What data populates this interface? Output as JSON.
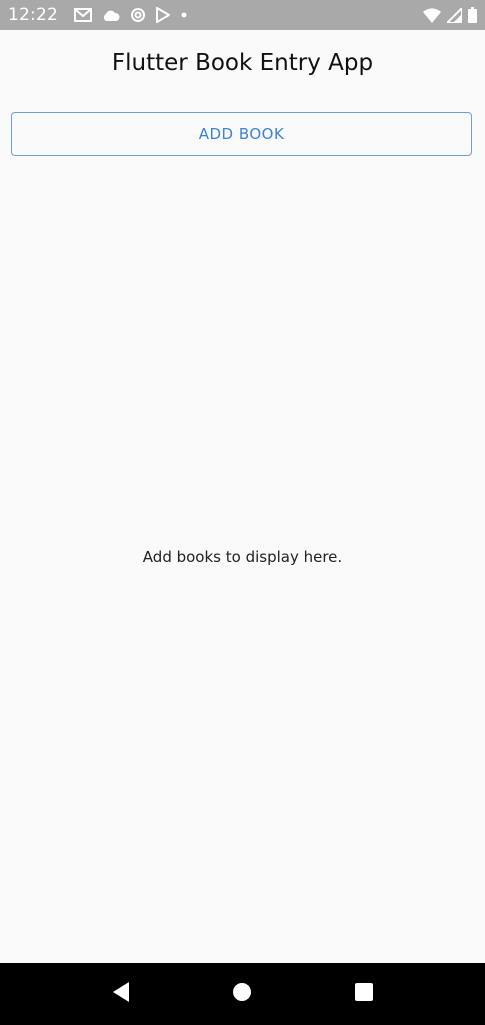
{
  "status_bar": {
    "time": "12:22",
    "left_icons": [
      "gmail-icon",
      "cloud-icon",
      "sync-icon",
      "play-store-icon",
      "dot-icon"
    ],
    "right_icons": [
      "wifi-icon",
      "signal-icon",
      "battery-icon"
    ]
  },
  "app": {
    "title": "Flutter Book Entry App",
    "add_button_label": "ADD BOOK",
    "empty_message": "Add books to display here."
  },
  "nav_bar": {
    "buttons": [
      "back-icon",
      "home-icon",
      "recents-icon"
    ]
  },
  "colors": {
    "status_bar_bg": "#a9a9a9",
    "background": "#fafafa",
    "accent": "#3d82d6",
    "nav_bar_bg": "#000000"
  }
}
